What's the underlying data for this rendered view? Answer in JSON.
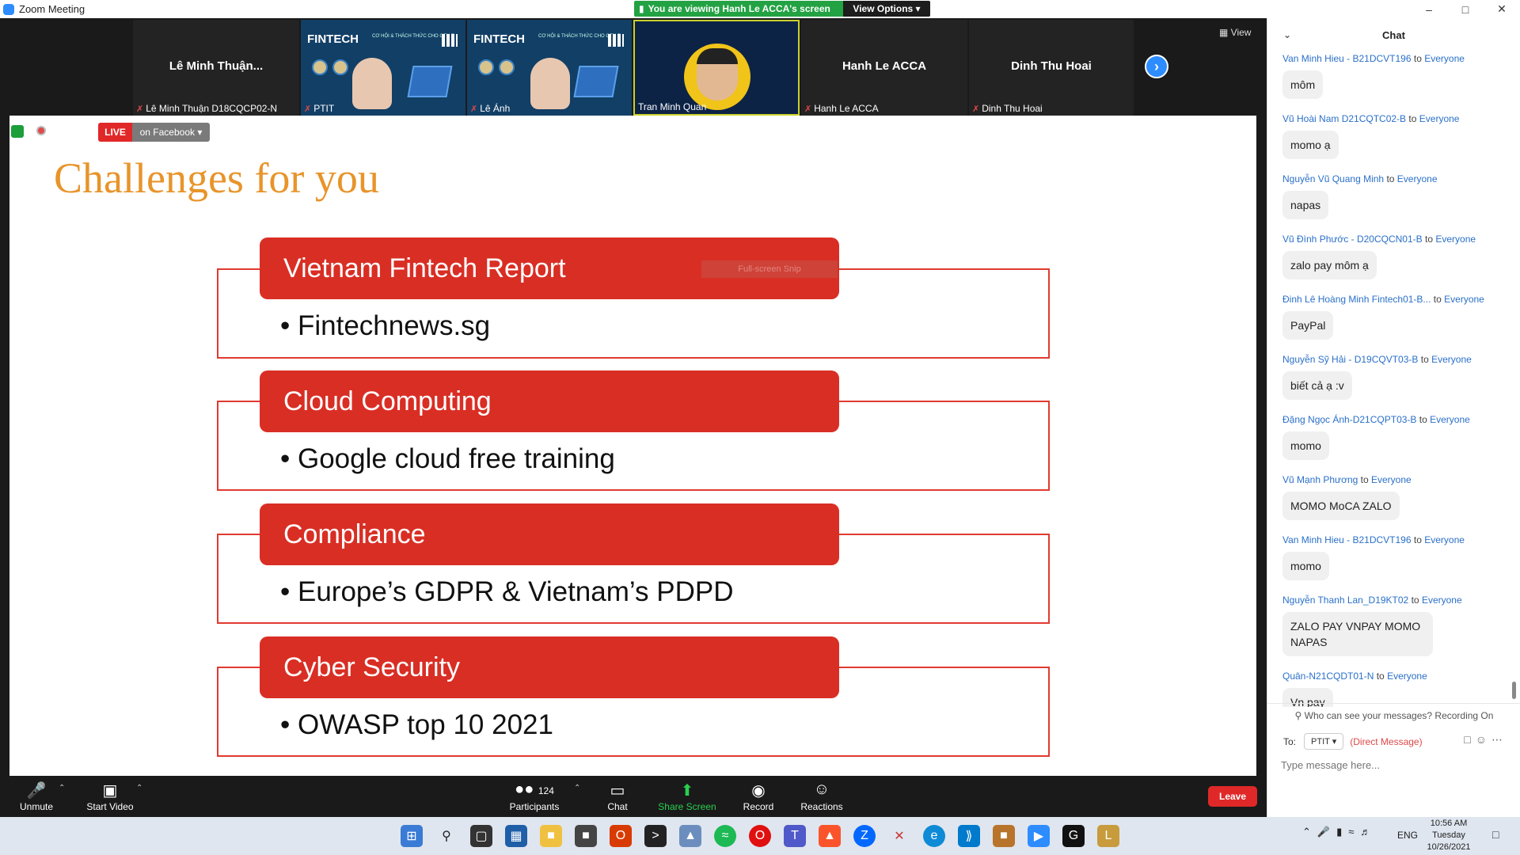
{
  "window": {
    "title": "Zoom Meeting"
  },
  "banner": {
    "viewing": "You are viewing Hanh Le ACCA's screen",
    "view_options": "View Options ▾"
  },
  "window_controls": {
    "min": "–",
    "max": "□",
    "close": "✕"
  },
  "strip": {
    "view_label": "View",
    "tiles": [
      {
        "name": "Lê Minh Thuận...",
        "label": "Lê Minh Thuận D18CQCP02-N",
        "muted": true
      },
      {
        "name": "",
        "label": "PTIT",
        "muted": true,
        "brand": "FINTECH",
        "sub": "CƠ HỘI & THÁCH THỨC CHO GEN Z"
      },
      {
        "name": "",
        "label": "Lê Ánh",
        "muted": true,
        "brand": "FINTECH",
        "sub": "CƠ HỘI & THÁCH THỨC CHO GEN Z"
      },
      {
        "name": "",
        "label": "Tran Minh Quan",
        "muted": false
      },
      {
        "name": "Hanh Le ACCA",
        "label": "Hanh Le ACCA",
        "muted": true
      },
      {
        "name": "Dinh Thu Hoai",
        "label": "Dinh Thu Hoai",
        "muted": true
      }
    ]
  },
  "share_bar": {
    "live": "LIVE",
    "platform": "on Facebook ▾"
  },
  "slide": {
    "title": "Challenges for you",
    "snip_ghost": "Full-screen Snip",
    "blocks": [
      {
        "header": "Vietnam Fintech Report",
        "bullet": "•  Fintechnews.sg"
      },
      {
        "header": "Cloud Computing",
        "bullet": "•  Google cloud free training"
      },
      {
        "header": "Compliance",
        "bullet": "•  Europe’s GDPR & Vietnam’s PDPD"
      },
      {
        "header": "Cyber Security",
        "bullet": "•  OWASP top 10 2021"
      }
    ]
  },
  "toolbar": {
    "unmute": "Unmute",
    "start_video": "Start Video",
    "participants": "Participants",
    "participants_count": "124",
    "chat": "Chat",
    "share_screen": "Share Screen",
    "record": "Record",
    "reactions": "Reactions",
    "leave": "Leave"
  },
  "chat": {
    "title": "Chat",
    "to_word": "to",
    "messages": [
      {
        "sender": "Van Minh Hieu - B21DCVT196",
        "to": "Everyone",
        "text": "môm"
      },
      {
        "sender": "Vũ Hoài Nam D21CQTC02-B",
        "to": "Everyone",
        "text": "momo ạ"
      },
      {
        "sender": "Nguyễn Vũ Quang Minh",
        "to": "Everyone",
        "text": "napas"
      },
      {
        "sender": "Vũ Đình Phước - D20CQCN01-B",
        "to": "Everyone",
        "text": "zalo pay môm ạ"
      },
      {
        "sender": "Đinh Lê Hoàng Minh Fintech01-B...",
        "to": "Everyone",
        "text": "PayPal"
      },
      {
        "sender": "Nguyễn Sỹ Hải - D19CQVT03-B",
        "to": "Everyone",
        "text": "biết cả ạ :v"
      },
      {
        "sender": "Đặng Ngọc Ánh-D21CQPT03-B",
        "to": "Everyone",
        "text": "momo"
      },
      {
        "sender": "Vũ Mạnh Phương",
        "to": "Everyone",
        "text": "MOMO MoCA ZALO"
      },
      {
        "sender": "Van Minh Hieu - B21DCVT196",
        "to": "Everyone",
        "text": "momo"
      },
      {
        "sender": "Nguyễn Thanh Lan_D19KT02",
        "to": "Everyone",
        "text": "ZALO PAY VNPAY MOMO NAPAS"
      },
      {
        "sender": "Quân-N21CQDT01-N",
        "to": "Everyone",
        "text": "Vn pay"
      }
    ],
    "recording_note": "Who can see your messages? Recording On",
    "to_label": "To:",
    "to_value": "PTIT ▾",
    "direct_message": "(Direct Message)",
    "placeholder": "Type message here..."
  },
  "taskbar": {
    "lang": "ENG",
    "time": "10:56 AM",
    "day": "Tuesday",
    "date": "10/26/2021"
  },
  "colors": {
    "accent": "#2d8cff",
    "slide_red": "#d92e24",
    "title_orange": "#e8942a",
    "share_green": "#23a243"
  }
}
